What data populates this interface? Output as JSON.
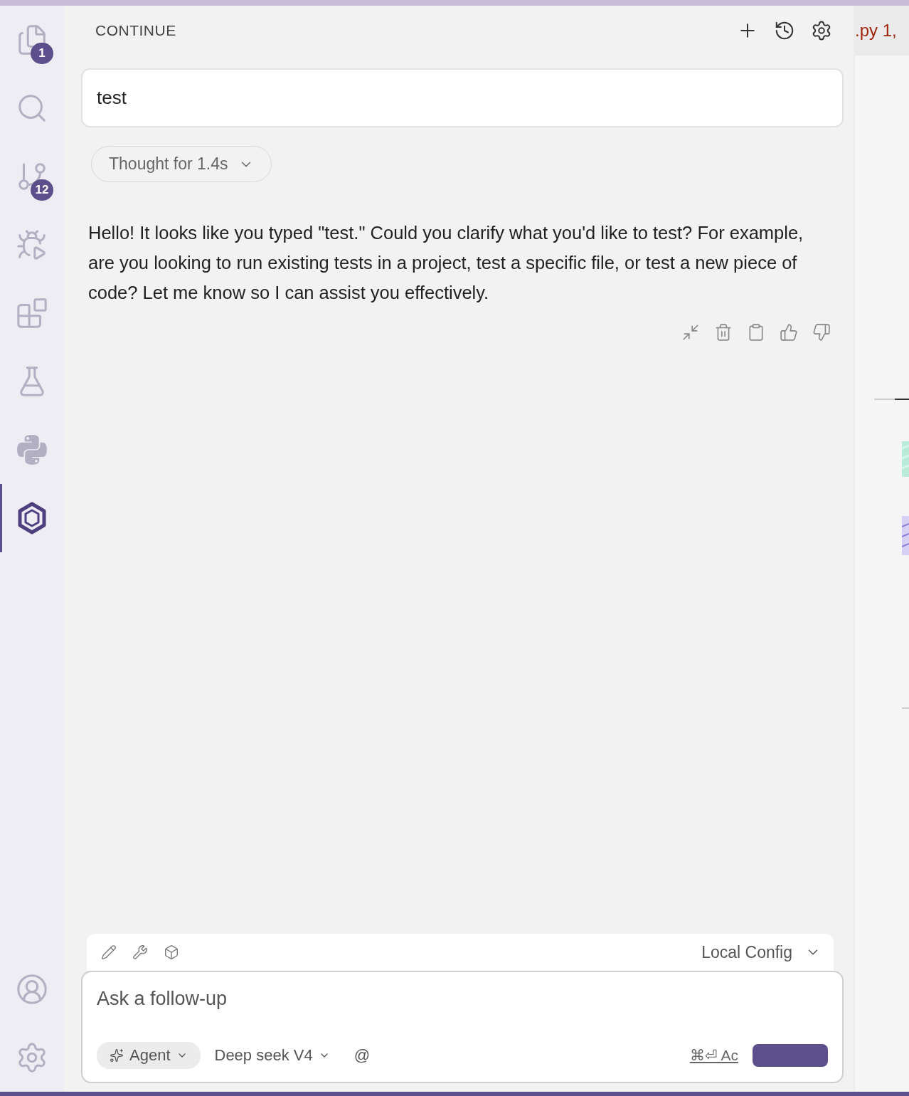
{
  "activity_bar": {
    "items": [
      {
        "kind": "files",
        "badge": "1",
        "selected": false
      },
      {
        "kind": "search",
        "selected": false
      },
      {
        "kind": "source-control",
        "badge": "12",
        "selected": false
      },
      {
        "kind": "run-debug",
        "selected": false
      },
      {
        "kind": "extensions",
        "selected": false
      },
      {
        "kind": "testing",
        "selected": false
      },
      {
        "kind": "python",
        "selected": false
      },
      {
        "kind": "continue",
        "selected": true
      }
    ],
    "bottom_items": [
      {
        "kind": "account"
      },
      {
        "kind": "settings"
      }
    ]
  },
  "panel": {
    "title": "CONTINUE",
    "actions": [
      {
        "kind": "new"
      },
      {
        "kind": "history"
      },
      {
        "kind": "settings"
      }
    ]
  },
  "conversation": {
    "user_message": "test",
    "thought": {
      "label": "Thought for 1.4s",
      "expanded": false
    },
    "reply": "Hello! It looks like you typed \"test.\" Could you clarify what you'd like to test? For example, are you looking to run existing tests in a project, test a specific file, or test a new piece of code? Let me know so I can assist you effectively.",
    "reply_actions": [
      {
        "kind": "collapse"
      },
      {
        "kind": "delete"
      },
      {
        "kind": "copy"
      },
      {
        "kind": "thumbs-up"
      },
      {
        "kind": "thumbs-down"
      }
    ]
  },
  "input": {
    "tools": [
      {
        "kind": "edit"
      },
      {
        "kind": "tools"
      },
      {
        "kind": "blocks"
      }
    ],
    "config": "Local Config",
    "placeholder": "Ask a follow-up",
    "mode": "Agent",
    "model": "Deep seek V4",
    "mention": "@",
    "shortcut_hint": "⌘⏎ Ac"
  },
  "editor_behind": {
    "tab": ".py 1,"
  }
}
